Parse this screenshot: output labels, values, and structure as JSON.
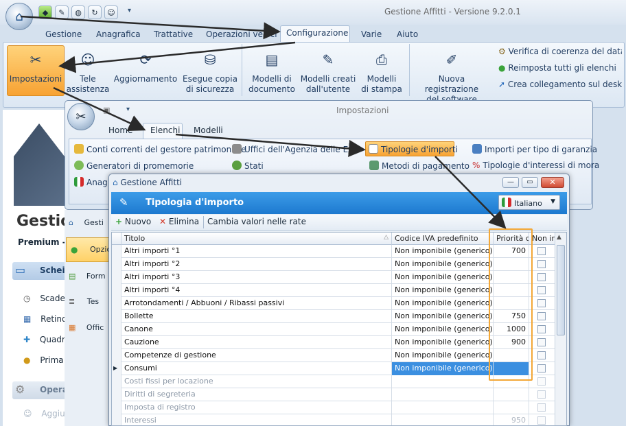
{
  "app": {
    "title": "Gestione Affitti - Versione 9.2.0.1"
  },
  "main_tabs": [
    "Gestione",
    "Anagrafica",
    "Trattative",
    "Operazioni veloci",
    "Configurazione",
    "Varie",
    "Aiuto"
  ],
  "ribbon": {
    "impostazioni": "Impostazioni",
    "tele_1": "Tele",
    "tele_2": "assistenza",
    "aggiornamento": "Aggiornamento",
    "copia_1": "Esegue copia",
    "copia_2": "di sicurezza",
    "modelli_doc_1": "Modelli di",
    "modelli_doc_2": "documento",
    "modelli_ut_1": "Modelli creati",
    "modelli_ut_2": "dall'utente",
    "modelli_st_1": "Modelli",
    "modelli_st_2": "di stampa",
    "nuova_1": "Nuova registrazione",
    "nuova_2": "del software",
    "verifica": "Verifica di coerenza del databa",
    "reimposta": "Reimposta tutti gli elenchi",
    "collegamento": "Crea collegamento sul desktop"
  },
  "sidebar": {
    "brand": "Gestio",
    "premium": "Premium -",
    "section1": "Schei",
    "items1": [
      "Scade",
      "Retino",
      "Quadri",
      "Prima"
    ],
    "section2": "Opera",
    "items2": [
      "Aggiu"
    ]
  },
  "impwin": {
    "title": "Impostazioni",
    "tabs": [
      "Home",
      "Elenchi",
      "Modelli"
    ],
    "side_items": [
      "Gesti",
      "Opzio",
      "Form",
      "Tes",
      "Offic"
    ],
    "links": {
      "conti": "Conti correnti del gestore patrimoniale",
      "uffici": "Uffici dell'Agenzia delle Entrate",
      "tipologie": "Tipologie d'importi",
      "importi_garanzia": "Importi per tipo di garanzia",
      "generatori": "Generatori di promemorie",
      "stati": "Stati",
      "metodi": "Metodi di pagamento",
      "interessi": "Tipologie d'interessi di mora",
      "anag": "Anag"
    }
  },
  "dialog": {
    "title": "Gestione Affitti",
    "header": "Tipologia d'importo",
    "language": "Italiano",
    "toolbar": {
      "nuovo": "Nuovo",
      "elimina": "Elimina",
      "cambia": "Cambia valori nelle rate"
    },
    "columns": [
      "Titolo",
      "Codice IVA predefinito",
      "Priorità ca",
      "Non inc"
    ],
    "rows": [
      {
        "titolo": "Altri importi °1",
        "codice": "Non imponibile (generico)",
        "priorita": "700"
      },
      {
        "titolo": "Altri importi °2",
        "codice": "Non imponibile (generico)",
        "priorita": ""
      },
      {
        "titolo": "Altri importi °3",
        "codice": "Non imponibile (generico)",
        "priorita": ""
      },
      {
        "titolo": "Altri importi °4",
        "codice": "Non imponibile (generico)",
        "priorita": ""
      },
      {
        "titolo": "Arrotondamenti / Abbuoni / Ribassi passivi",
        "codice": "Non imponibile (generico)",
        "priorita": ""
      },
      {
        "titolo": "Bollette",
        "codice": "Non imponibile (generico)",
        "priorita": "750"
      },
      {
        "titolo": "Canone",
        "codice": "Non imponibile (generico)",
        "priorita": "1000"
      },
      {
        "titolo": "Cauzione",
        "codice": "Non imponibile (generico)",
        "priorita": "900"
      },
      {
        "titolo": "Competenze di gestione",
        "codice": "Non imponibile (generico)",
        "priorita": ""
      },
      {
        "titolo": "Consumi",
        "codice": "Non imponibile (generico)",
        "priorita": ""
      },
      {
        "titolo": "Costi fissi per locazione",
        "codice": "",
        "priorita": ""
      },
      {
        "titolo": "Diritti di segreteria",
        "codice": "",
        "priorita": ""
      },
      {
        "titolo": "Imposta di registro",
        "codice": "",
        "priorita": ""
      },
      {
        "titolo": "Interessi",
        "codice": "",
        "priorita": "950"
      }
    ]
  },
  "colors": {
    "accent_orange": "#f7a233",
    "header_blue": "#1d79cf",
    "selected_row": "#3b8fe0"
  }
}
